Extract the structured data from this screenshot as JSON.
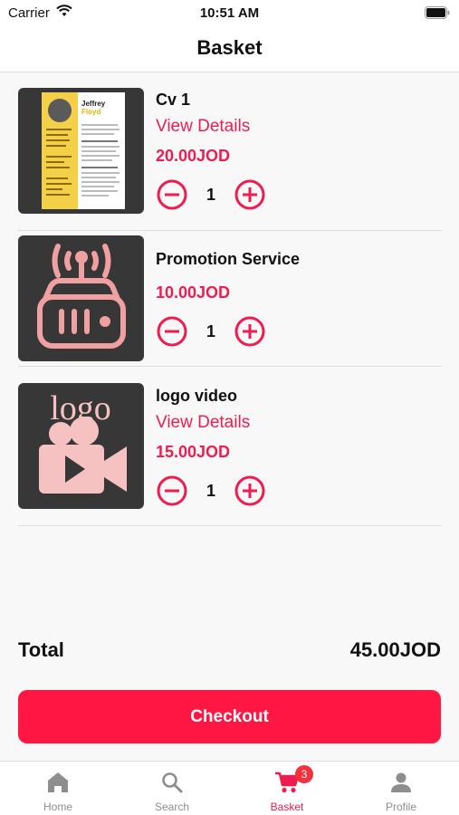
{
  "status_bar": {
    "carrier": "Carrier",
    "time": "10:51 AM"
  },
  "nav": {
    "title": "Basket"
  },
  "items": [
    {
      "name": "Cv 1",
      "link": "View Details",
      "price": "20.00JOD",
      "quantity": "1",
      "thumbnail_text": {
        "first_name": "Jeffrey",
        "last_name": "Floyd"
      }
    },
    {
      "name": "Promotion Service",
      "price": "10.00JOD",
      "quantity": "1"
    },
    {
      "name": "logo video",
      "link": "View Details",
      "price": "15.00JOD",
      "quantity": "1",
      "thumbnail_text": {
        "logo": "logo"
      }
    }
  ],
  "total": {
    "label": "Total",
    "value": "45.00JOD"
  },
  "checkout": {
    "label": "Checkout"
  },
  "tabs": [
    {
      "label": "Home",
      "icon": "home-icon"
    },
    {
      "label": "Search",
      "icon": "search-icon"
    },
    {
      "label": "Basket",
      "icon": "cart-icon",
      "badge": "3",
      "active": true
    },
    {
      "label": "Profile",
      "icon": "person-icon"
    }
  ],
  "colors": {
    "accent": "#ee1d4f",
    "button": "#ff1744",
    "thumb_bg": "#383738",
    "thumb_art": "#f0a0a0",
    "badge": "#f5323b"
  }
}
